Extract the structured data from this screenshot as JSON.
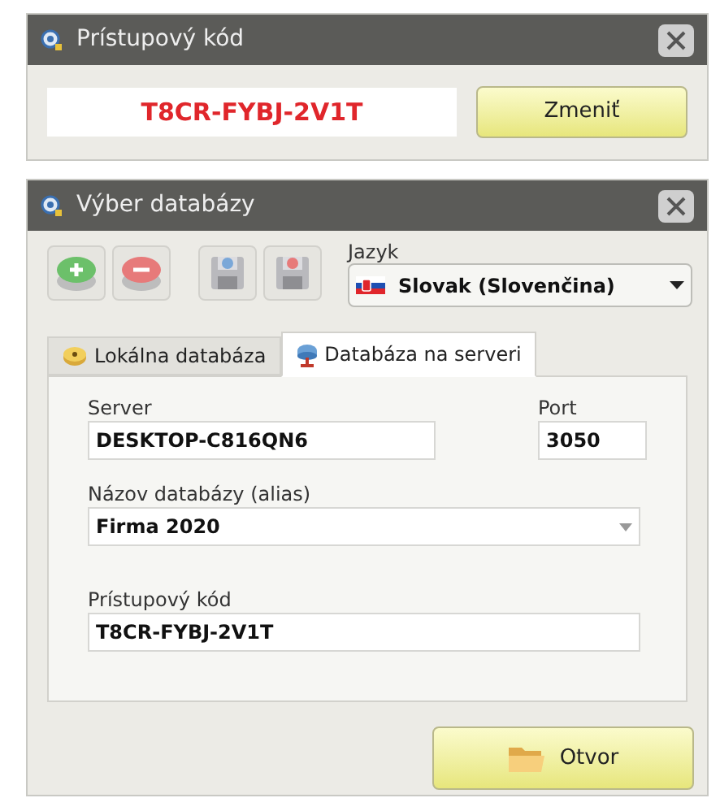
{
  "access_dialog": {
    "title": "Prístupový kód",
    "code": "T8CR-FYBJ-2V1T",
    "button": "Zmeniť"
  },
  "database_dialog": {
    "title": "Výber databázy",
    "toolbar": [
      {
        "kind": "add"
      },
      {
        "kind": "remove"
      },
      {
        "kind": "download"
      },
      {
        "kind": "upload"
      }
    ],
    "language": {
      "label": "Jazyk",
      "value": "Slovak (Slovenčina)"
    },
    "tabs": [
      {
        "label": "Lokálna databáza",
        "kind": "local",
        "selected": false
      },
      {
        "label": "Databáza na serveri",
        "kind": "server",
        "selected": true
      }
    ],
    "server": {
      "label": "Server",
      "value": "DESKTOP-C816QN6"
    },
    "port": {
      "label": "Port",
      "value": "3050"
    },
    "alias": {
      "label": "Názov databázy (alias)",
      "value": "Firma 2020"
    },
    "code": {
      "label": "Prístupový kód",
      "value": "T8CR-FYBJ-2V1T"
    },
    "open_button": "Otvor"
  }
}
